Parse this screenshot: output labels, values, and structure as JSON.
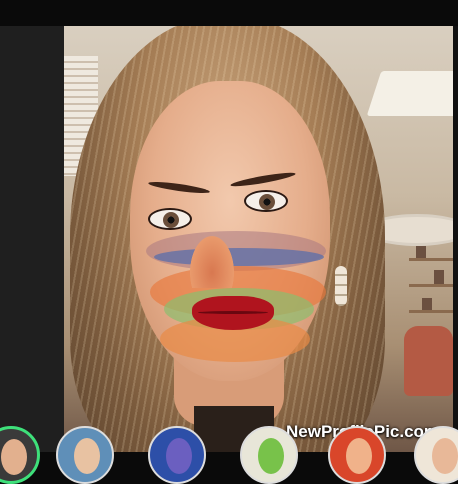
{
  "watermark": {
    "text": "NewProfilePic.com"
  },
  "effects": {
    "selected_index": 0,
    "accent_color": "#3ee07a",
    "items": [
      {
        "id": "effect-1",
        "bg": "#3a3a3a",
        "skin": "#e2b08e",
        "selected": true
      },
      {
        "id": "effect-2",
        "bg": "#5f8fb8",
        "skin": "#e8c2a2",
        "selected": false
      },
      {
        "id": "effect-3",
        "bg": "#2d4fa8",
        "skin": "#6b5fc0",
        "selected": false
      },
      {
        "id": "effect-4",
        "bg": "#e8e6d8",
        "skin": "#78c24a",
        "selected": false
      },
      {
        "id": "effect-5",
        "bg": "#d9462a",
        "skin": "#f0b28a",
        "selected": false
      },
      {
        "id": "effect-6",
        "bg": "#efe6d8",
        "skin": "#e8b898",
        "selected": false
      }
    ]
  },
  "colors": {
    "background": "#0a0a0a",
    "side_panel": "#1f1f1f"
  }
}
